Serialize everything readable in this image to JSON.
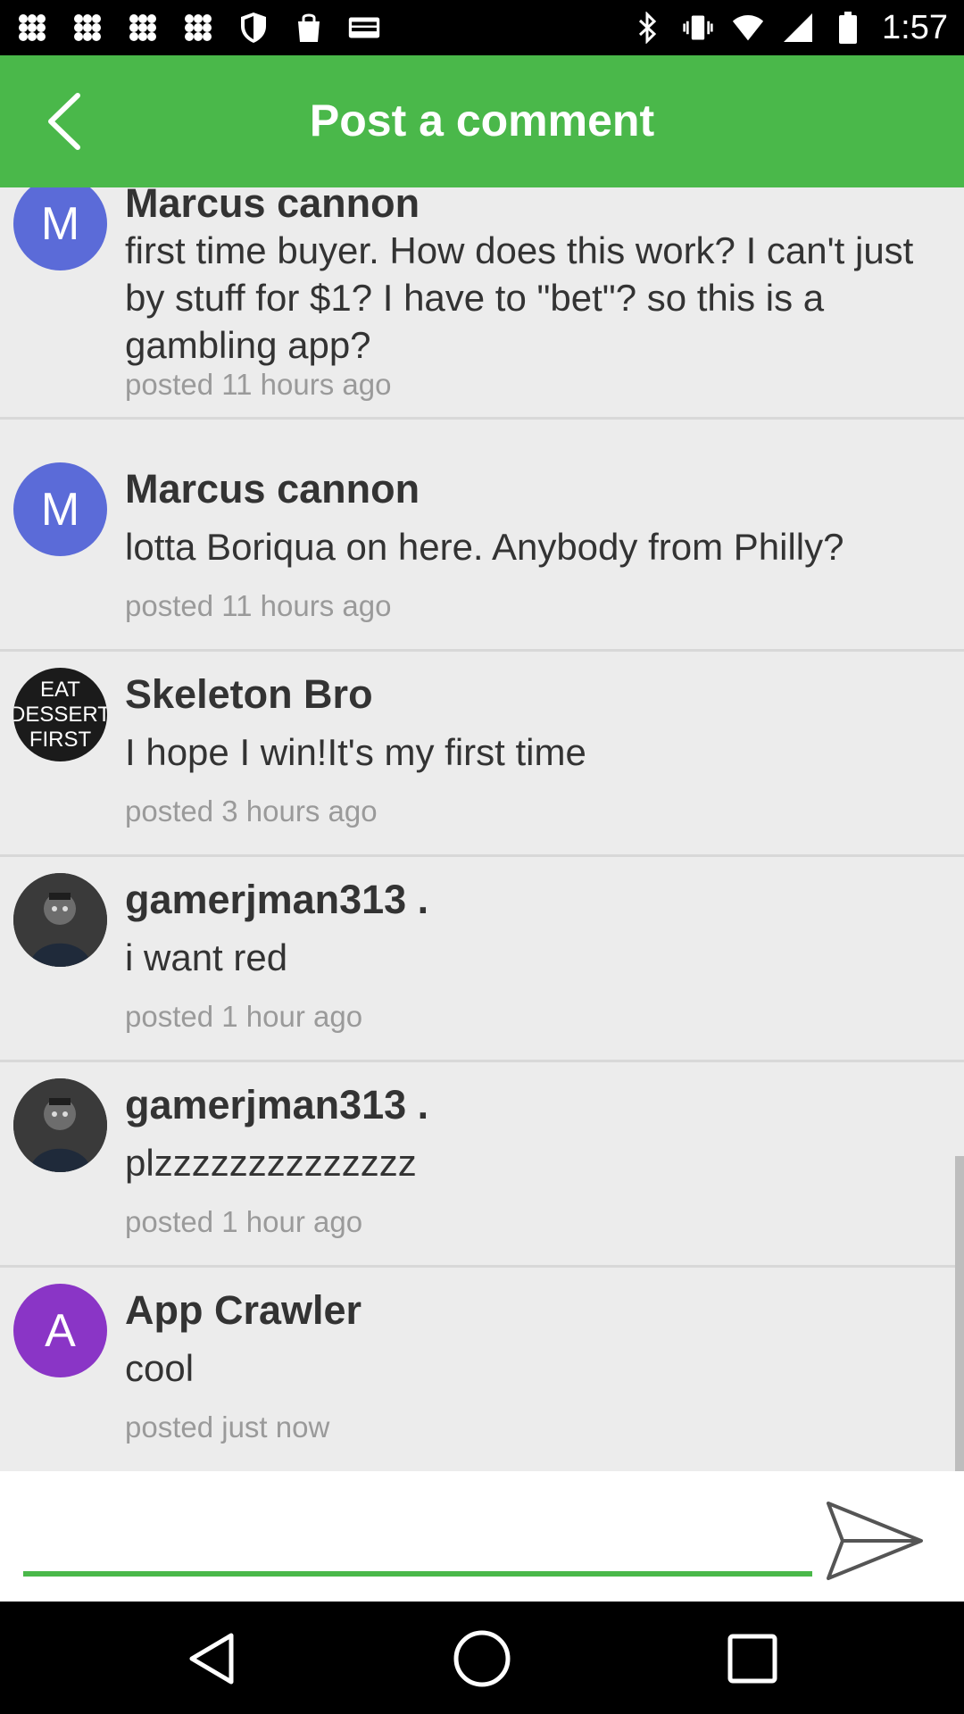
{
  "status_bar": {
    "time": "1:57",
    "left_icons": [
      "app-icon",
      "app-icon",
      "app-icon",
      "app-icon",
      "shield-icon",
      "bag-icon",
      "espn-dallas-icon"
    ],
    "right_icons": [
      "bluetooth-icon",
      "vibrate-icon",
      "wifi-icon",
      "signal-icon",
      "battery-icon"
    ]
  },
  "app_bar": {
    "title": "Post a comment",
    "background_color": "#4ab84a"
  },
  "comments": [
    {
      "author": "Marcus cannon",
      "avatar_text": "M",
      "body": "first time buyer. How does this work? I can't just by stuff for $1?  I have to \"bet\"? so this is a gambling app?",
      "timestamp": "posted 11 hours ago"
    },
    {
      "author": "Marcus cannon",
      "avatar_text": "M",
      "body": "lotta Boriqua on here. Anybody from Philly?",
      "timestamp": "posted 11 hours ago"
    },
    {
      "author": "Skeleton Bro",
      "avatar_lines": [
        "EAT",
        "DESSERT",
        "FIRST"
      ],
      "body": "I hope I win!It's my first time",
      "timestamp": "posted 3 hours ago"
    },
    {
      "author": "gamerjman313 .",
      "avatar_icon": "profile-photo",
      "body": "i want red",
      "timestamp": "posted 1 hour ago"
    },
    {
      "author": "gamerjman313 .",
      "avatar_icon": "profile-photo",
      "body": "plzzzzzzzzzzzzzz",
      "timestamp": "posted 1 hour ago"
    },
    {
      "author": "App Crawler",
      "avatar_text": "A",
      "body": "cool",
      "timestamp": "posted just now"
    }
  ],
  "input": {
    "value": "",
    "send_icon": "send-icon"
  },
  "nav_bar": {
    "icons": [
      "back-triangle-icon",
      "home-circle-icon",
      "recents-square-icon"
    ]
  }
}
